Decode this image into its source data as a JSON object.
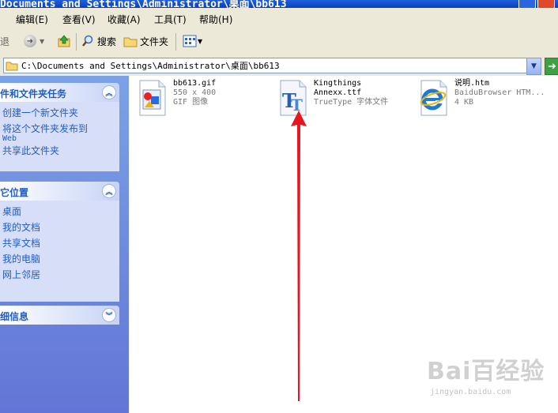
{
  "window": {
    "title": "Documents and Settings\\Administrator\\桌面\\bb613"
  },
  "menu": {
    "items": [
      "编辑(E)",
      "查看(V)",
      "收藏(A)",
      "工具(T)",
      "帮助(H)"
    ]
  },
  "toolbar": {
    "back_partial": "退",
    "search_label": "搜索",
    "folders_label": "文件夹"
  },
  "address": {
    "path": "C:\\Documents and Settings\\Administrator\\桌面\\bb613"
  },
  "sidebar": {
    "panels": [
      {
        "title": "件和文件夹任务",
        "expanded": true,
        "links": [
          "创建一个新文件夹",
          "将这个文件夹发布到",
          "Web",
          "共享此文件夹"
        ]
      },
      {
        "title": "它位置",
        "expanded": true,
        "links": [
          "桌面",
          "我的文档",
          "共享文档",
          "我的电脑",
          "网上邻居"
        ]
      },
      {
        "title": "细信息",
        "expanded": false,
        "links": []
      }
    ]
  },
  "files": [
    {
      "name": "bb613.gif",
      "line2": "550 x 400",
      "line3": "GIF 图像",
      "icon": "gif-image-icon"
    },
    {
      "name": "Kingthings",
      "line2": "Annexx.ttf",
      "line3": "TrueType 字体文件",
      "icon": "truetype-font-icon"
    },
    {
      "name": "说明.htm",
      "line2": "BaiduBrowser HTM...",
      "line3": "4 KB",
      "icon": "ie-html-icon"
    }
  ],
  "watermark": {
    "logo_text": "Bai百经验",
    "url": "jingyan.baidu.com"
  },
  "colors": {
    "titlebar": "#0a3fbd",
    "sidebar": "#6375d6",
    "link": "#215dc6",
    "arrow": "#e8141e"
  }
}
